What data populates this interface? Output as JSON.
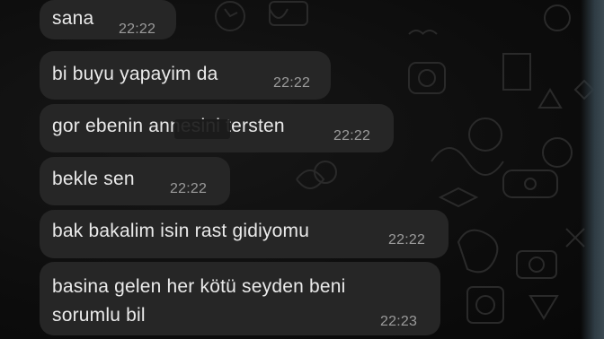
{
  "messages": [
    {
      "text": "sana",
      "time": "22:22"
    },
    {
      "text": "bi buyu yapayim da",
      "time": "22:22"
    },
    {
      "text": "gor ebenin annesini tersten",
      "time": "22:22"
    },
    {
      "text": "bekle sen",
      "time": "22:22"
    },
    {
      "text": "bak bakalim isin rast gidiyomu",
      "time": "22:22"
    },
    {
      "text_line1": "basina gelen her kötü seyden beni",
      "text_line2": "sorumlu bil",
      "time": "22:23"
    }
  ],
  "theme": {
    "bubble_color": "#262626",
    "text_color": "#eaeaea",
    "time_color": "#9b9b9b",
    "background": "#0c0c0c"
  }
}
